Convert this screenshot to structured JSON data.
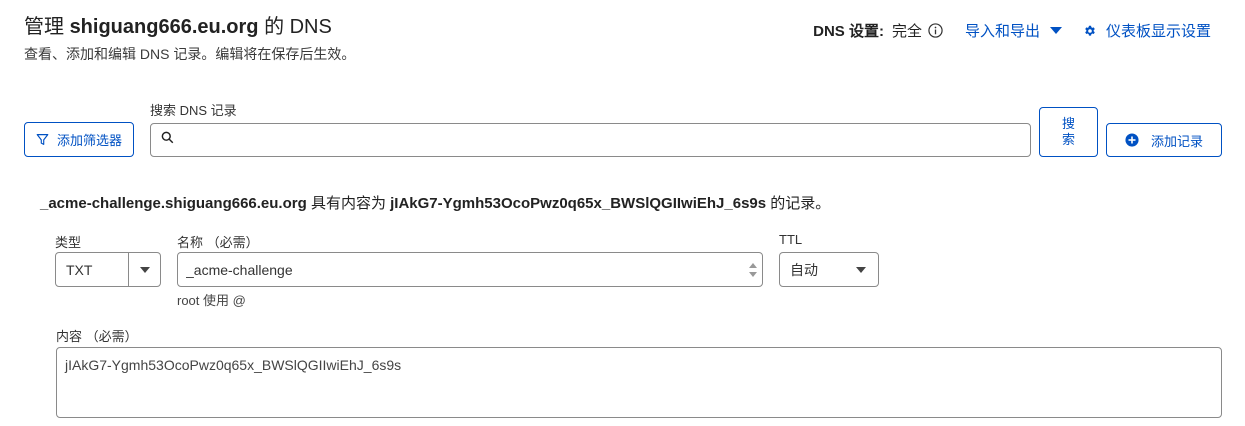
{
  "header": {
    "title_prefix": "管理",
    "title_domain": "shiguang666.eu.org",
    "title_suffix": "的 DNS",
    "subtitle": "查看、添加和编辑 DNS 记录。编辑将在保存后生效。"
  },
  "toolbar": {
    "dns_setting_label": "DNS 设置:",
    "dns_setting_value": "完全",
    "import_export": "导入和导出",
    "dashboard_settings": "仪表板显示设置"
  },
  "search": {
    "filter_button": "添加筛选器",
    "label": "搜索 DNS 记录",
    "placeholder": "",
    "search_button_line1": "搜",
    "search_button_line2": "索",
    "add_record_button": "添加记录"
  },
  "record": {
    "desc_name": "_acme-challenge.shiguang666.eu.org",
    "desc_mid": "具有内容为",
    "desc_content": "jIAkG7-Ygmh53OcoPwz0q65x_BWSlQGIIwiEhJ_6s9s",
    "desc_tail": "的记录。",
    "type_label": "类型",
    "type_value": "TXT",
    "name_label": "名称 （必需）",
    "name_value": "_acme-challenge",
    "name_hint": "root 使用 @",
    "ttl_label": "TTL",
    "ttl_value": "自动",
    "content_label": "内容 （必需）",
    "content_value": "jIAkG7-Ygmh53OcoPwz0q65x_BWSlQGIIwiEhJ_6s9s"
  },
  "colors": {
    "accent": "#0051c3",
    "border": "#8a8a8a",
    "text": "#313131"
  },
  "icons": [
    "info-icon",
    "chevron-down-icon",
    "gear-icon",
    "filter-icon",
    "search-icon",
    "plus-circle-icon",
    "spinner-icon"
  ]
}
